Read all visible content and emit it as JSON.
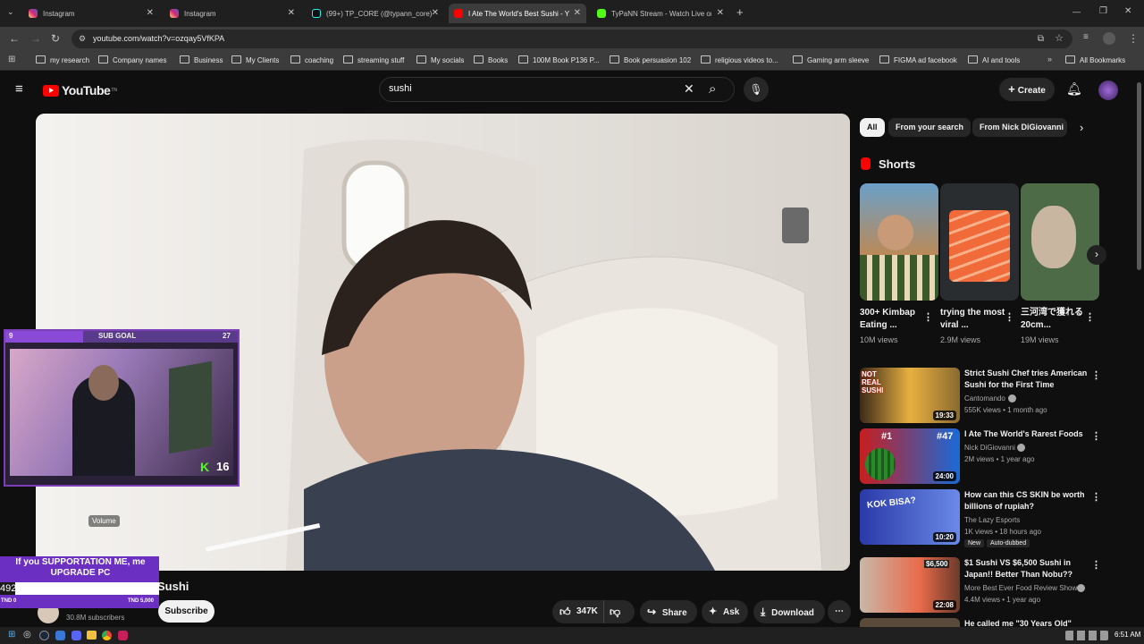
{
  "browser": {
    "tabs": [
      {
        "title": "Instagram",
        "color": "#d6249f"
      },
      {
        "title": "Instagram",
        "color": "#d6249f"
      },
      {
        "title": "(99+) TP_CORE (@typann_core)",
        "color": "#111111"
      },
      {
        "title": "I Ate The World's Best Sushi - Y",
        "color": "#ff0000"
      },
      {
        "title": "TyPaNN Stream - Watch Live on",
        "color": "#53fc18"
      }
    ],
    "new_tab": "+",
    "url": "youtube.com/watch?v=ozqay5VfKPA",
    "bookmarks": [
      "my research",
      "Company names",
      "Business",
      "My Clients",
      "coaching",
      "streaming stuff",
      "My socials",
      "Books",
      "100M Book P136 P...",
      "Book persuasion 102",
      "religious videos to...",
      "Gaming arm sleeve",
      "FIGMA ad facebook",
      "AI and tools"
    ],
    "all_bookmarks": "All Bookmarks"
  },
  "youtube": {
    "logo": "YouTube",
    "logo_sup": "TN",
    "search_query": "sushi",
    "create_label": "Create"
  },
  "chips": [
    "All",
    "From your search",
    "From Nick DiGiovanni"
  ],
  "shorts": {
    "heading": "Shorts",
    "items": [
      {
        "title": "300+ Kimbap Eating ...",
        "views": "10M views"
      },
      {
        "title": "trying the most viral ...",
        "views": "2.9M views"
      },
      {
        "title": "三河湾で獲れる20cm...",
        "views": "19M views"
      }
    ]
  },
  "recommendations": [
    {
      "title": "Strict Sushi Chef tries American Sushi for the First Time",
      "channel": "Cantomando",
      "meta": "555K views • 1 month ago",
      "duration": "19:33",
      "thumb_text": "NOT REAL SUSHI"
    },
    {
      "title": "I Ate The World's Rarest Foods",
      "channel": "Nick DiGiovanni",
      "meta": "2M views • 1 year ago",
      "duration": "24:00",
      "thumb_text": "#1",
      "thumb_text2": "#47"
    },
    {
      "title": "How can this CS SKIN be worth billions of rupiah?",
      "channel": "The Lazy Esports",
      "meta": "1K views • 18 hours ago",
      "duration": "10:20",
      "thumb_text": "KOK BISA?",
      "badges": [
        "New",
        "Auto-dubbed"
      ]
    },
    {
      "title": "$1 Sushi VS $6,500 Sushi in Japan!! Better Than Nobu??",
      "channel": "More Best Ever Food Review Show",
      "meta": "4.4M views • 1 year ago",
      "duration": "22:08",
      "thumb_text": "$6,500"
    },
    {
      "title": "He called me \"30 Years Old\"",
      "channel": "",
      "meta": "",
      "duration": "",
      "thumb_text": ""
    }
  ],
  "video": {
    "title_visible": "Sushi",
    "subscribers": "30.8M subscribers",
    "subscribe": "Subscribe",
    "likes": "347K",
    "share": "Share",
    "ask": "Ask",
    "download": "Download",
    "volume_tooltip": "Volume"
  },
  "overlay": {
    "sub_goal_label": "SUB GOAL",
    "sub_goal_current": "9",
    "sub_goal_target": "27",
    "kick_count": "16",
    "donate_line": "If you SUPPORTATION ME, me UPGRADE PC",
    "donate_amount": "492",
    "donate_min": "TND 0",
    "donate_max": "TND 5,000",
    "donate_progress": 0.098
  },
  "taskbar": {
    "time": "6:51 AM"
  }
}
